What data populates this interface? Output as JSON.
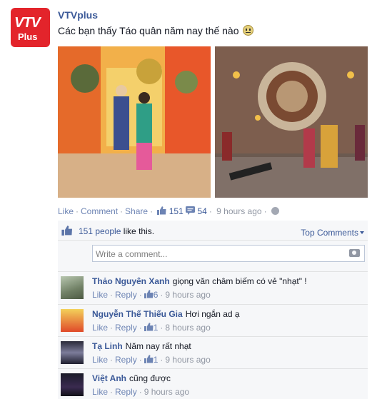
{
  "post": {
    "page_name": "VTVplus",
    "avatar_text_top": "VTV",
    "avatar_text_bottom": "Plus",
    "text": "Các bạn thấy Táo quân năm nay thế nào",
    "emoji_icon": "neutral-face-icon",
    "photos": [
      "photo-stage-1",
      "photo-stage-2"
    ]
  },
  "actions": {
    "like": "Like",
    "comment": "Comment",
    "share": "Share",
    "likes_count": "151",
    "comments_count": "54",
    "time": "9 hours ago"
  },
  "ufi": {
    "likes_link": "151 people",
    "likes_suffix": " like this.",
    "top_comments": "Top Comments",
    "comment_placeholder": "Write a comment..."
  },
  "comments": [
    {
      "author": "Thảo Nguyên Xanh",
      "text": "giọng văn châm biếm có vẻ \"nhạt\" !",
      "like": "Like",
      "reply": "Reply",
      "likes": "6",
      "time": "9 hours ago"
    },
    {
      "author": "Nguyễn Thế Thiếu Gia",
      "text": "Hơi ngắn ad ạ",
      "like": "Like",
      "reply": "Reply",
      "likes": "1",
      "time": "8 hours ago"
    },
    {
      "author": "Tạ Linh",
      "text": "Năm nay rất nhạt",
      "like": "Like",
      "reply": "Reply",
      "likes": "1",
      "time": "9 hours ago"
    },
    {
      "author": "Việt Anh",
      "text": "cũng được",
      "like": "Like",
      "reply": "Reply",
      "time": "9 hours ago"
    }
  ],
  "colors": {
    "link": "#3b5998",
    "action_link": "#6d84b4",
    "muted": "#9197a3",
    "brand_red": "#e3242b"
  }
}
